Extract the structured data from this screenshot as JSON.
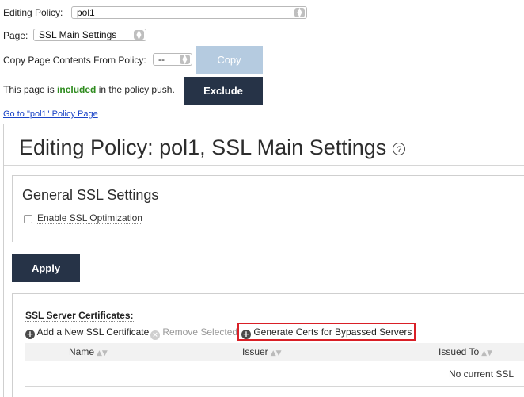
{
  "policy_row": {
    "label": "Editing Policy:",
    "value": "pol1"
  },
  "page_row": {
    "label": "Page:",
    "value": "SSL Main Settings"
  },
  "copy_row": {
    "label": "Copy Page Contents From Policy:",
    "value": "--",
    "button": "Copy"
  },
  "push_row": {
    "prefix": "This page is ",
    "status": "included",
    "suffix": " in the policy push.",
    "button": "Exclude"
  },
  "goto_link": "Go to \"pol1\" Policy Page",
  "main": {
    "title": "Editing Policy: pol1, SSL Main Settings",
    "help_glyph": "?"
  },
  "general": {
    "title": "General SSL Settings",
    "checkbox_label": "Enable SSL Optimization",
    "checked": false
  },
  "apply_button": "Apply",
  "certs": {
    "title": "SSL Server Certificates:",
    "actions": {
      "add": "Add a New SSL Certificate",
      "remove": "Remove Selected",
      "generate": "Generate Certs for Bypassed Servers"
    },
    "columns": [
      "Name",
      "Issuer",
      "Issued To"
    ],
    "empty_message": "No current SSL"
  },
  "colors": {
    "dark_button": "#263347",
    "disabled_button": "#b5cbe0",
    "included_text": "#2e8b1e",
    "highlight_box": "#d91f26",
    "link": "#1a44c7"
  },
  "icons": {
    "select_arrows": "updown-arrows-icon",
    "add": "plus-circle-icon",
    "remove": "x-circle-icon",
    "generate": "plus-circle-icon",
    "help": "question-circle-icon"
  }
}
